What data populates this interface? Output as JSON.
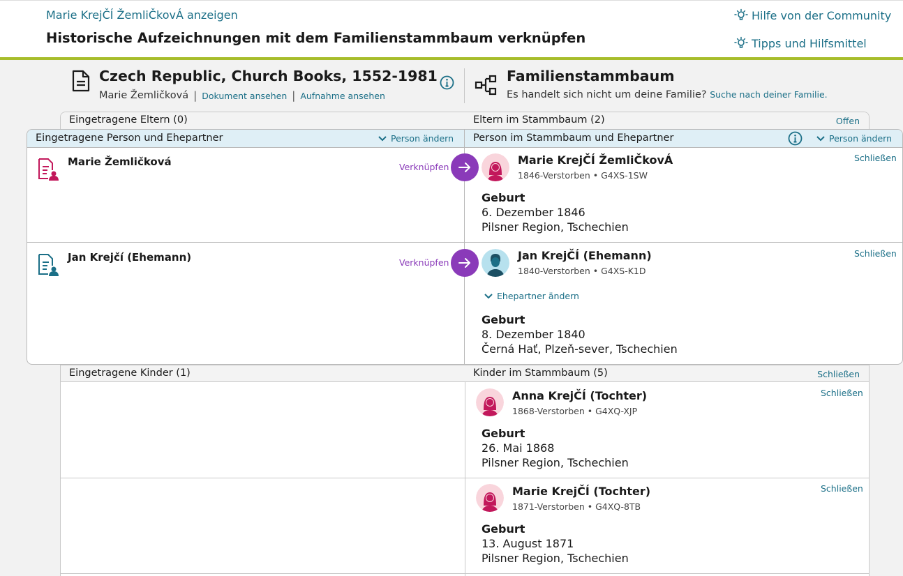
{
  "header": {
    "view_link": "Marie KrejČÍ ŽemliČkovÁ anzeigen",
    "title": "Historische Aufzeichnungen mit dem Familienstammbaum verknüpfen",
    "community_help": "Hilfe von der Community",
    "tips": "Tipps und Hilfsmittel"
  },
  "source": {
    "title": "Czech Republic, Church Books, 1552-1981",
    "person": "Marie Žemličková",
    "sep": "|",
    "view_document": "Dokument ansehen",
    "view_image": "Aufnahme ansehen"
  },
  "tree": {
    "title": "Familienstammbaum",
    "not_your_family": "Es handelt sich nicht um deine Familie?",
    "search_family": "Suche nach deiner Familie."
  },
  "parents_bar": {
    "left": "Eingetragene Eltern (0)",
    "right": "Eltern im Stammbaum (2)",
    "action": "Offen"
  },
  "person_bar": {
    "left": "Eingetragene Person und Ehepartner",
    "change_left": "Person ändern",
    "right": "Person im Stammbaum und Ehepartner",
    "change_right": "Person ändern"
  },
  "rows": [
    {
      "record_name": "Marie Žemličková",
      "link_label": "Verknüpfen",
      "tree_name": "Marie KrejČÍ ŽemliČkovÁ",
      "meta": "1846-Verstorben • G4XS-1SW",
      "close": "Schließen",
      "event_label": "Geburt",
      "event_date": "6. Dezember 1846",
      "event_place": "Pilsner Region, Tschechien"
    },
    {
      "record_name": "Jan Krejčí (Ehemann)",
      "link_label": "Verknüpfen",
      "tree_name": "Jan KrejČÍ (Ehemann)",
      "meta": "1840-Verstorben • G4XS-K1D",
      "close": "Schließen",
      "spouse_change": "Ehepartner ändern",
      "event_label": "Geburt",
      "event_date": "8. Dezember 1840",
      "event_place": "Černá Hať, Plzeň-sever, Tschechien"
    }
  ],
  "children_bar": {
    "left": "Eingetragene Kinder (1)",
    "right": "Kinder im Stammbaum (5)",
    "action": "Schließen"
  },
  "children": [
    {
      "name": "Anna KrejČÍ (Tochter)",
      "meta": "1868-Verstorben • G4XQ-XJP",
      "close": "Schließen",
      "event_label": "Geburt",
      "event_date": "26. Mai 1868",
      "event_place": "Pilsner Region, Tschechien"
    },
    {
      "name": "Marie KrejČÍ (Tochter)",
      "meta": "1871-Verstorben • G4XQ-8TB",
      "close": "Schließen",
      "event_label": "Geburt",
      "event_date": "13. August 1871",
      "event_place": "Pilsner Region, Tschechien"
    }
  ],
  "colors": {
    "accent": "#1b6f87",
    "link_purple": "#8a3ab9",
    "brand_green": "#a7bd2b",
    "female": "#c2185b",
    "male": "#1b6f87"
  }
}
